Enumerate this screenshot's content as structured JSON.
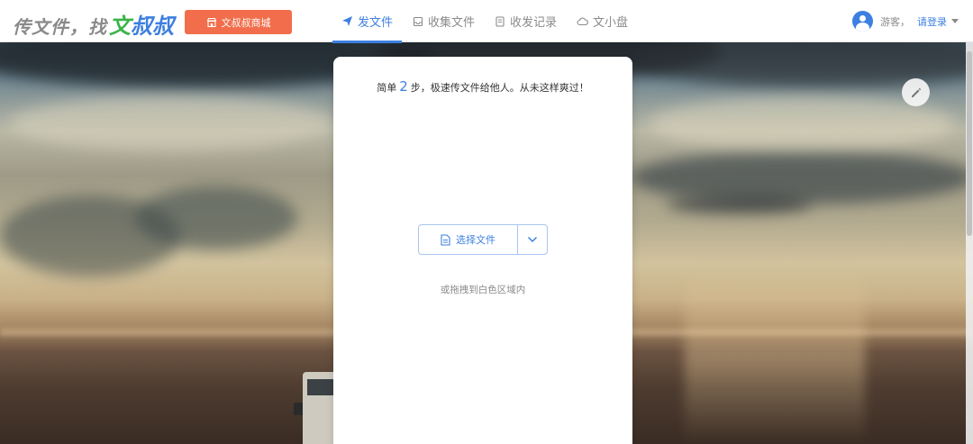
{
  "header": {
    "logo": {
      "lead": "传文件，找",
      "green": "文",
      "blue": "叔叔"
    },
    "shop_button": "文叔叔商城",
    "nav": [
      {
        "label": "发文件",
        "icon": "send-icon",
        "active": true
      },
      {
        "label": "收集文件",
        "icon": "collect-icon",
        "active": false
      },
      {
        "label": "收发记录",
        "icon": "record-icon",
        "active": false
      },
      {
        "label": "文小盘",
        "icon": "cloud-disk-icon",
        "active": false
      }
    ],
    "user": {
      "guest_label": "游客，",
      "login_label": "请登录"
    }
  },
  "card": {
    "tagline_before": "简单",
    "tagline_num": "2",
    "tagline_after": "步，极速传文件给他人。从未这样爽过！",
    "choose_button": "选择文件",
    "drag_hint": "或拖拽到白色区域内"
  },
  "colors": {
    "accent": "#3d7fe0",
    "shop": "#f26d4b",
    "logo_green": "#3bb44a"
  }
}
